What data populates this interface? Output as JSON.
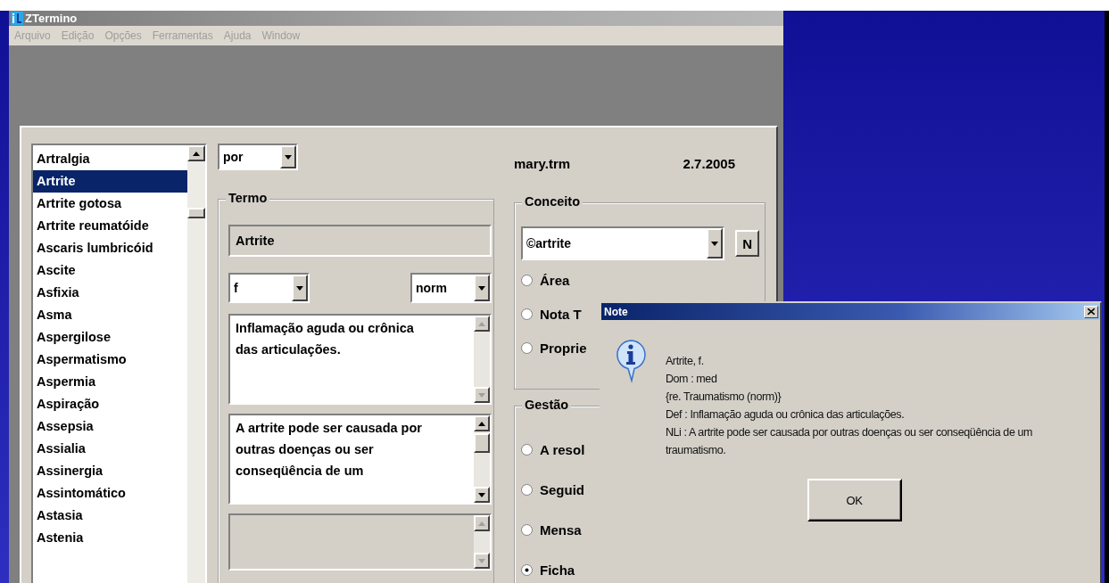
{
  "window": {
    "title": "ZTermino"
  },
  "menu": [
    {
      "label": "Arquivo",
      "disabled": true
    },
    {
      "label": "Edição",
      "disabled": true
    },
    {
      "label": "Opções",
      "disabled": true
    },
    {
      "label": "Ferramentas",
      "disabled": true
    },
    {
      "label": "Ajuda",
      "disabled": true
    },
    {
      "label": "Window",
      "disabled": true
    }
  ],
  "term_list": [
    {
      "label": "Artralgia",
      "selected": false
    },
    {
      "label": "Artrite",
      "selected": true
    },
    {
      "label": "Artrite gotosa",
      "selected": false
    },
    {
      "label": "Artrite reumatóide",
      "selected": false
    },
    {
      "label": "Ascaris lumbricóid",
      "selected": false
    },
    {
      "label": "Ascite",
      "selected": false
    },
    {
      "label": "Asfixia",
      "selected": false
    },
    {
      "label": "Asma",
      "selected": false
    },
    {
      "label": "Aspergilose",
      "selected": false
    },
    {
      "label": "Aspermatismo",
      "selected": false
    },
    {
      "label": "Aspermia",
      "selected": false
    },
    {
      "label": "Aspiração",
      "selected": false
    },
    {
      "label": "Assepsia",
      "selected": false
    },
    {
      "label": "Assialia",
      "selected": false
    },
    {
      "label": "Assinergia",
      "selected": false
    },
    {
      "label": "Assintomático",
      "selected": false
    },
    {
      "label": "Astasia",
      "selected": false
    },
    {
      "label": "Astenia",
      "selected": false
    }
  ],
  "language": "por",
  "file": "mary.trm",
  "date": "2.7.2005",
  "termo": {
    "title": "Termo",
    "term": "Artrite",
    "gender": "f",
    "status": "norm",
    "fields": [
      {
        "text": "Inflamação aguda ou crônica das articulações.",
        "disabled": false
      },
      {
        "text": "A artrite pode ser causada por outras doenças ou ser conseqüência de um",
        "disabled": false
      },
      {
        "disabled": true
      }
    ]
  },
  "conceito": {
    "title": "Conceito",
    "concept": "©artrite",
    "new_button": "N",
    "options": [
      {
        "label": "Área",
        "selected": false
      },
      {
        "label": "Nota T",
        "selected": false
      },
      {
        "label": "Proprie",
        "selected": false
      }
    ]
  },
  "gestao": {
    "title": "Gestão",
    "options": [
      {
        "label": "A resol",
        "selected": false
      },
      {
        "label": "Seguid",
        "selected": false
      },
      {
        "label": "Mensa",
        "selected": false
      },
      {
        "label": "Ficha",
        "selected": true
      }
    ]
  },
  "dialog": {
    "title": "Note",
    "lines": [
      "Artrite, f.",
      "Dom  : med",
      "{re. Traumatismo (norm)}",
      "Def  : Inflamação aguda ou crônica das articulações.",
      "NLi  : A artrite pode ser causada por outras doenças ou ser conseqüência de um traumatismo."
    ],
    "button": "OK"
  }
}
